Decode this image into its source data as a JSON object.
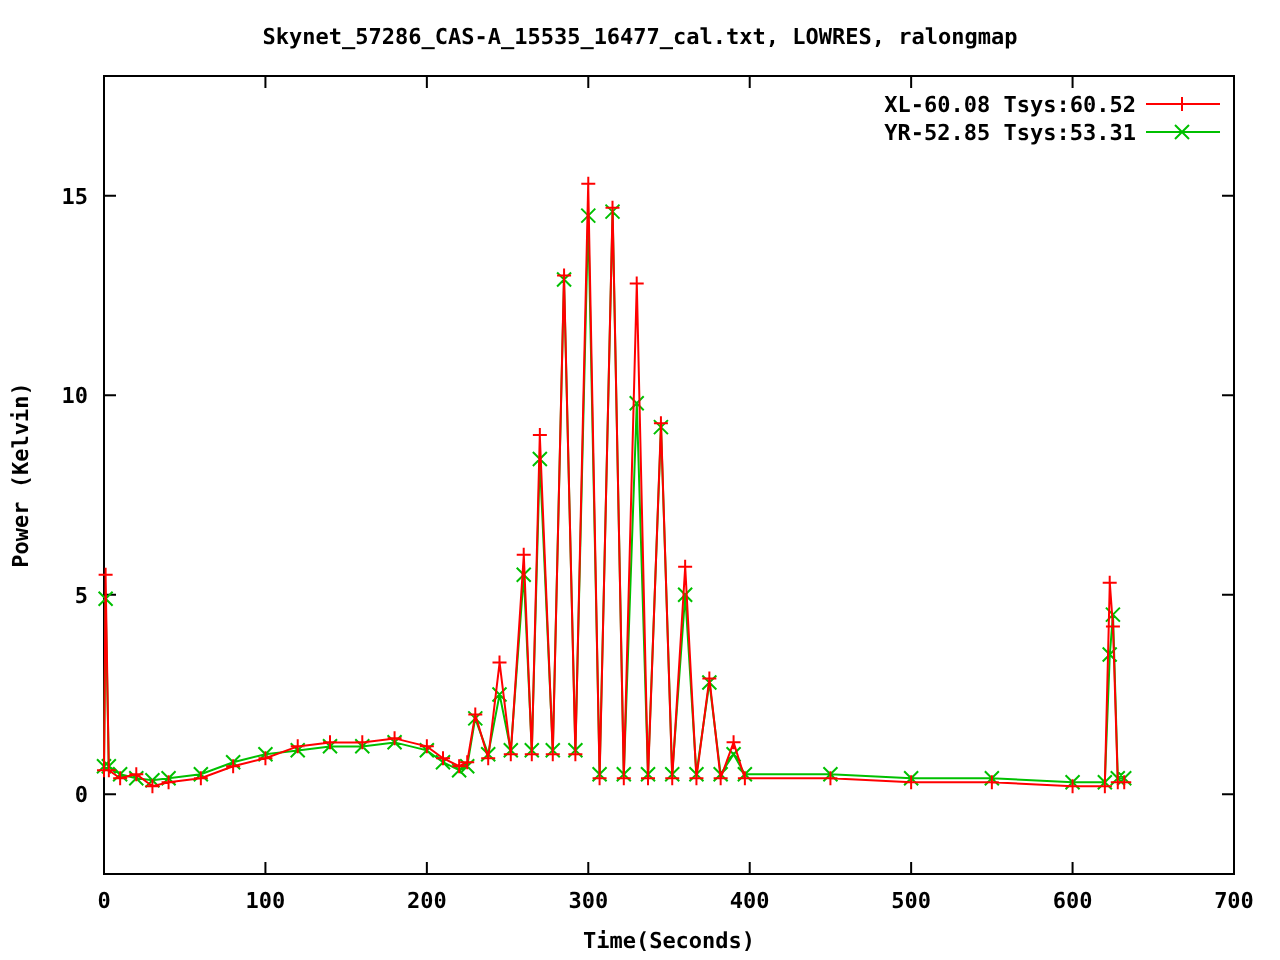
{
  "chart_data": {
    "type": "line",
    "title": "Skynet_57286_CAS-A_15535_16477_cal.txt, LOWRES, ralongmap",
    "xlabel": "Time(Seconds)",
    "ylabel": "Power (Kelvin)",
    "xlim": [
      0,
      700
    ],
    "ylim": [
      -2,
      18
    ],
    "xticks": [
      0,
      100,
      200,
      300,
      400,
      500,
      600,
      700
    ],
    "yticks": [
      0,
      5,
      10,
      15
    ],
    "legend": true,
    "x": [
      0,
      1,
      3,
      10,
      20,
      30,
      40,
      60,
      80,
      100,
      120,
      140,
      160,
      180,
      200,
      210,
      220,
      225,
      230,
      238,
      245,
      252,
      260,
      265,
      270,
      278,
      285,
      292,
      300,
      307,
      315,
      322,
      330,
      337,
      345,
      352,
      360,
      367,
      375,
      382,
      390,
      397,
      450,
      500,
      550,
      600,
      620,
      623,
      625,
      628,
      632
    ],
    "series": [
      {
        "name": "XL-60.08 Tsys:60.52",
        "color": "#ff0000",
        "marker": "plus",
        "values": [
          0.6,
          5.5,
          0.6,
          0.4,
          0.5,
          0.2,
          0.3,
          0.4,
          0.7,
          0.9,
          1.2,
          1.3,
          1.3,
          1.4,
          1.2,
          0.9,
          0.7,
          0.8,
          2.0,
          0.9,
          3.3,
          1.0,
          6.0,
          1.0,
          9.0,
          1.0,
          13.0,
          1.0,
          15.3,
          0.4,
          14.7,
          0.4,
          12.8,
          0.4,
          9.3,
          0.4,
          5.7,
          0.4,
          2.9,
          0.4,
          1.3,
          0.4,
          0.4,
          0.3,
          0.3,
          0.2,
          0.2,
          5.3,
          4.2,
          0.3,
          0.3
        ]
      },
      {
        "name": "YR-52.85 Tsys:53.31",
        "color": "#00c000",
        "marker": "cross",
        "values": [
          0.7,
          4.9,
          0.7,
          0.5,
          0.4,
          0.35,
          0.4,
          0.5,
          0.8,
          1.0,
          1.1,
          1.2,
          1.2,
          1.3,
          1.1,
          0.8,
          0.6,
          0.7,
          1.9,
          1.0,
          2.5,
          1.1,
          5.5,
          1.1,
          8.4,
          1.1,
          12.9,
          1.1,
          14.5,
          0.5,
          14.6,
          0.5,
          9.8,
          0.5,
          9.2,
          0.5,
          5.0,
          0.5,
          2.8,
          0.5,
          1.0,
          0.5,
          0.5,
          0.4,
          0.4,
          0.3,
          0.3,
          3.5,
          4.5,
          0.4,
          0.4
        ]
      }
    ]
  }
}
